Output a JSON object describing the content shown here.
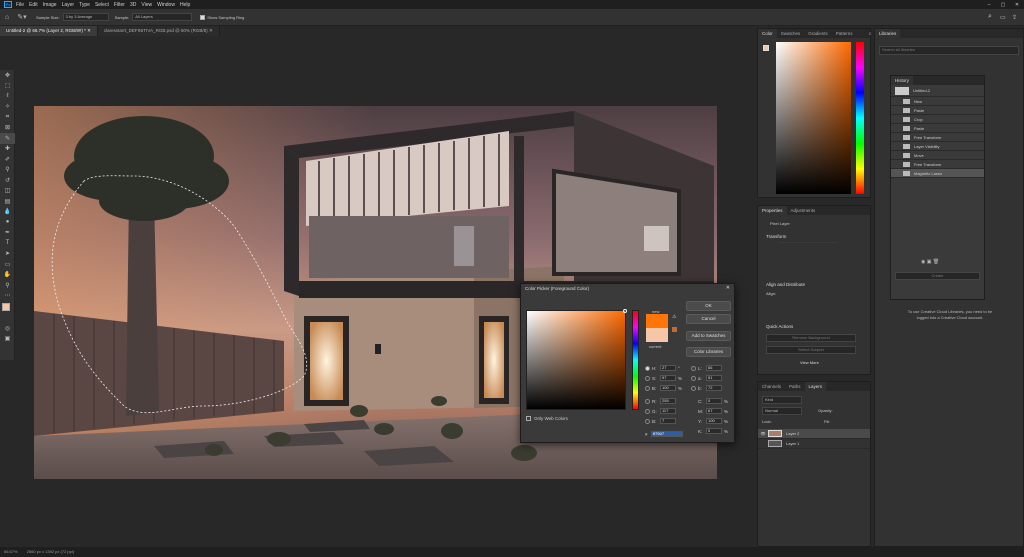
{
  "menu": [
    "File",
    "Edit",
    "Image",
    "Layer",
    "Type",
    "Select",
    "Filter",
    "3D",
    "View",
    "Window",
    "Help"
  ],
  "options": {
    "sample_size_label": "Sample Size:",
    "sample_size_value": "3 by 3 Average",
    "sample_label": "Sample:",
    "sample_value": "All Layers",
    "show_ring_label": "Show Sampling Ring"
  },
  "doc_tabs": [
    {
      "label": "Untitled-2 @ 66.7% (Layer 2, RGB/8#) *"
    },
    {
      "label": "claresstarrt_DEFINITIVA_RGB.psd @ 50% (RGB/8)"
    }
  ],
  "status": {
    "zoom": "66.67%",
    "doc_info": "2560 px x 1392 px (72 ppi)"
  },
  "color_panel": {
    "tabs": [
      "Color",
      "Swatches",
      "Gradients",
      "Patterns"
    ]
  },
  "libraries": {
    "tab": "Libraries",
    "search_placeholder": "Search all libraries",
    "message": "To use Creative Cloud Libraries, you need to be logged into a Creative Cloud account."
  },
  "history": {
    "title": "History",
    "snapshot": "Untitled-2",
    "items": [
      "New",
      "Paste",
      "Crop",
      "Paste",
      "Free Transform",
      "Layer Visibility",
      "Move",
      "Free Transform",
      "Magnetic Lasso"
    ],
    "create_label": "Create"
  },
  "properties": {
    "tabs": [
      "Properties",
      "Adjustments"
    ],
    "layer_type": "Pixel Layer",
    "transform_label": "Transform",
    "align_label": "Align and Distribute",
    "align_sub": "Align:",
    "quick_actions_label": "Quick Actions",
    "qa_buttons": [
      "Remove Background",
      "Select Subject"
    ],
    "view_more": "View More"
  },
  "layers_panel": {
    "tabs": [
      "Channels",
      "Paths",
      "Layers"
    ],
    "kind_placeholder": "Kind",
    "blend_mode": "Normal",
    "opacity_label": "Opacity:",
    "lock_label": "Lock:",
    "fill_label": "Fill:",
    "layers": [
      {
        "name": "Layer 2",
        "selected": true
      },
      {
        "name": "Layer 1",
        "selected": false
      }
    ]
  },
  "color_picker": {
    "title": "Color Picker (Foreground Color)",
    "buttons": [
      "OK",
      "Cancel",
      "Add to Swatches",
      "Color Libraries"
    ],
    "new_label": "new",
    "current_label": "current",
    "only_web_label": "Only Web Colors",
    "new_color": "#FF7507",
    "current_color": "#F5C6A8",
    "fields_left": [
      {
        "label": "H:",
        "value": "27",
        "unit": "°"
      },
      {
        "label": "S:",
        "value": "97",
        "unit": "%"
      },
      {
        "label": "B:",
        "value": "100",
        "unit": "%"
      },
      {
        "label": "R:",
        "value": "255",
        "unit": ""
      },
      {
        "label": "G:",
        "value": "117",
        "unit": ""
      },
      {
        "label": "B:",
        "value": "7",
        "unit": ""
      }
    ],
    "fields_right": [
      {
        "label": "L:",
        "value": "66",
        "unit": ""
      },
      {
        "label": "a:",
        "value": "51",
        "unit": ""
      },
      {
        "label": "b:",
        "value": "72",
        "unit": ""
      },
      {
        "label": "C:",
        "value": "0",
        "unit": "%"
      },
      {
        "label": "M:",
        "value": "67",
        "unit": "%"
      },
      {
        "label": "Y:",
        "value": "100",
        "unit": "%"
      },
      {
        "label": "K:",
        "value": "0",
        "unit": "%"
      }
    ],
    "hex_label": "#",
    "hex_value": "ff7507"
  },
  "colors": {
    "accent": "#ff7507",
    "foreground": "#f5c6a8",
    "app_bg": "#282828",
    "panel_bg": "#323232"
  }
}
